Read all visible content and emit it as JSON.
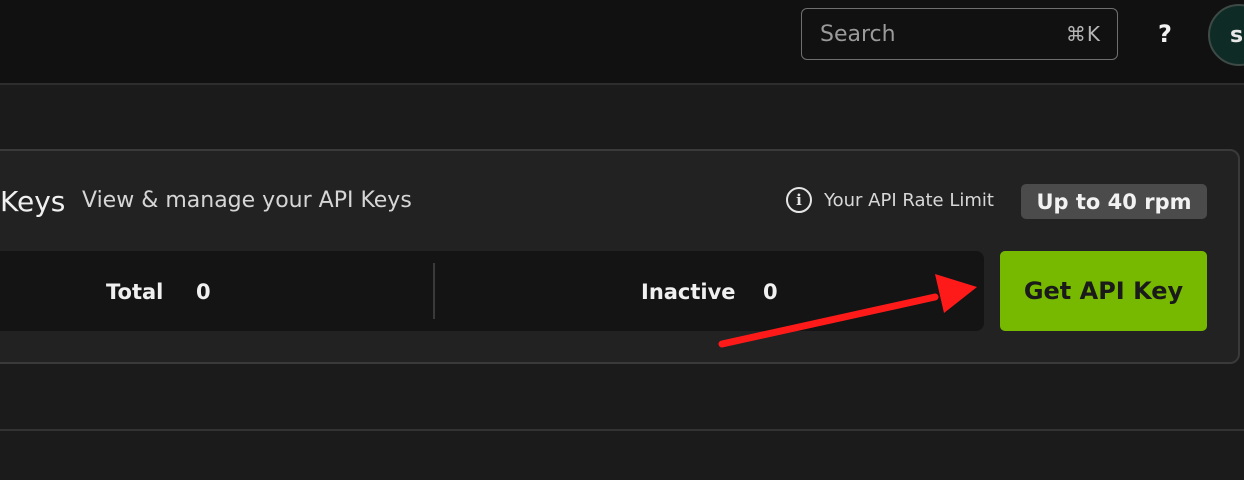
{
  "header": {
    "search_placeholder": "Search",
    "search_shortcut": "⌘K",
    "help_label": "?",
    "avatar_initial": "s"
  },
  "api_keys": {
    "title": "Keys",
    "subtitle": "View & manage your API Keys",
    "rate_limit_label": "Your API Rate Limit",
    "rate_limit_value": "Up to 40 rpm",
    "info_icon": "i",
    "stats": {
      "total_label": "Total",
      "total_value": "0",
      "inactive_label": "Inactive",
      "inactive_value": "0"
    },
    "get_key_label": "Get API Key"
  },
  "colors": {
    "accent": "#76b900",
    "annotation_arrow": "#ff1a1a"
  },
  "icons": {
    "info": "info-circle-icon",
    "help": "question-mark-icon",
    "annotation": "red-arrow-icon"
  }
}
